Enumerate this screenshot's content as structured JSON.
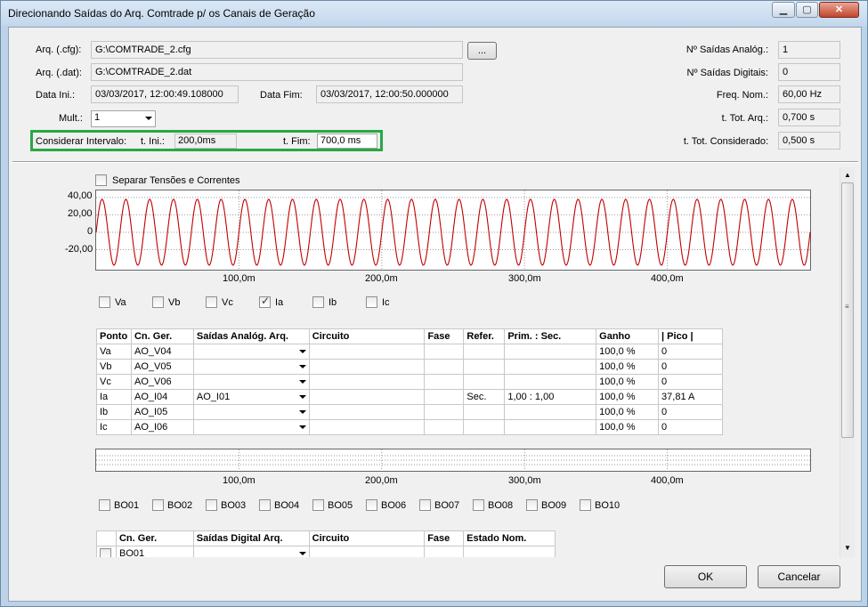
{
  "window": {
    "title": "Direcionando Saídas do Arq. Comtrade p/ os Canais de Geração",
    "minimize_icon": "minimize-icon",
    "maximize_icon": "maximize-icon",
    "close_icon": "close-icon"
  },
  "file": {
    "cfg_label": "Arq. (.cfg):",
    "cfg_value": "G:\\COMTRADE_2.cfg",
    "browse_label": "...",
    "dat_label": "Arq. (.dat):",
    "dat_value": "G:\\COMTRADE_2.dat",
    "data_ini_label": "Data Ini.:",
    "data_ini_value": "03/03/2017, 12:00:49.108000",
    "data_fim_label": "Data Fim:",
    "data_fim_value": "03/03/2017, 12:00:50.000000",
    "mult_label": "Mult.:",
    "mult_value": "1",
    "considerar_label": "Considerar Intervalo:",
    "t_ini_label": "t. Ini.:",
    "t_ini_value": "200,0ms",
    "t_fim_label": "t. Fim:",
    "t_fim_value": "700,0 ms"
  },
  "summary": {
    "saidas_analog_label": "Nº Saídas Analóg.:",
    "saidas_analog_value": "1",
    "saidas_digitais_label": "Nº Saídas Digitais:",
    "saidas_digitais_value": "0",
    "freq_label": "Freq. Nom.:",
    "freq_value": "60,00 Hz",
    "t_tot_arq_label": "t. Tot. Arq.:",
    "t_tot_arq_value": "0,700 s",
    "t_tot_cons_label": "t. Tot. Considerado:",
    "t_tot_cons_value": "0,500 s"
  },
  "separar_label": "Separar Tensões e Correntes",
  "chart_data": {
    "type": "line",
    "series": [
      {
        "color": "#c00000",
        "frequency_hz": 60,
        "amplitude": 37.81,
        "t_start_ms": 0,
        "t_end_ms": 500
      }
    ],
    "x_ticks": [
      "100,0m",
      "200,0m",
      "300,0m",
      "400,0m"
    ],
    "x_tick_values_ms": [
      100,
      200,
      300,
      400
    ],
    "xlim_ms": [
      0,
      500
    ],
    "y_ticks": [
      "40,00",
      "20,00",
      "0",
      "-20,00"
    ],
    "y_tick_values": [
      40,
      20,
      0,
      -20
    ],
    "ylim": [
      -43,
      48
    ],
    "grid": true
  },
  "digital_chart": {
    "x_ticks": [
      "100,0m",
      "200,0m",
      "300,0m",
      "400,0m"
    ]
  },
  "analog_checks": [
    {
      "label": "Va",
      "checked": false
    },
    {
      "label": "Vb",
      "checked": false
    },
    {
      "label": "Vc",
      "checked": false
    },
    {
      "label": "Ia",
      "checked": true
    },
    {
      "label": "Ib",
      "checked": false
    },
    {
      "label": "Ic",
      "checked": false
    }
  ],
  "analog_table": {
    "headers": [
      "Ponto",
      "Cn. Ger.",
      "Saídas Analóg. Arq.",
      "Circuito",
      "Fase",
      "Refer.",
      "Prim. : Sec.",
      "Ganho",
      "| Pico |"
    ],
    "rows": [
      [
        "Va",
        "AO_V04",
        "",
        "",
        "",
        "",
        "",
        "100,0 %",
        "0"
      ],
      [
        "Vb",
        "AO_V05",
        "",
        "",
        "",
        "",
        "",
        "100,0 %",
        "0"
      ],
      [
        "Vc",
        "AO_V06",
        "",
        "",
        "",
        "",
        "",
        "100,0 %",
        "0"
      ],
      [
        "Ia",
        "AO_I04",
        "AO_I01",
        "",
        "",
        "Sec.",
        "1,00 : 1,00",
        "100,0 %",
        "37,81 A"
      ],
      [
        "Ib",
        "AO_I05",
        "",
        "",
        "",
        "",
        "",
        "100,0 %",
        "0"
      ],
      [
        "Ic",
        "AO_I06",
        "",
        "",
        "",
        "",
        "",
        "100,0 %",
        "0"
      ]
    ]
  },
  "bo_checks": [
    "BO01",
    "BO02",
    "BO03",
    "BO04",
    "BO05",
    "BO06",
    "BO07",
    "BO08",
    "BO09",
    "BO10"
  ],
  "digital_table": {
    "headers": [
      "",
      "Cn. Ger.",
      "Saídas Digital Arq.",
      "Circuito",
      "Fase",
      "Estado Nom."
    ],
    "first_row": [
      "",
      "BO01",
      "",
      "",
      "",
      ""
    ]
  },
  "buttons": {
    "ok": "OK",
    "cancel": "Cancelar"
  }
}
